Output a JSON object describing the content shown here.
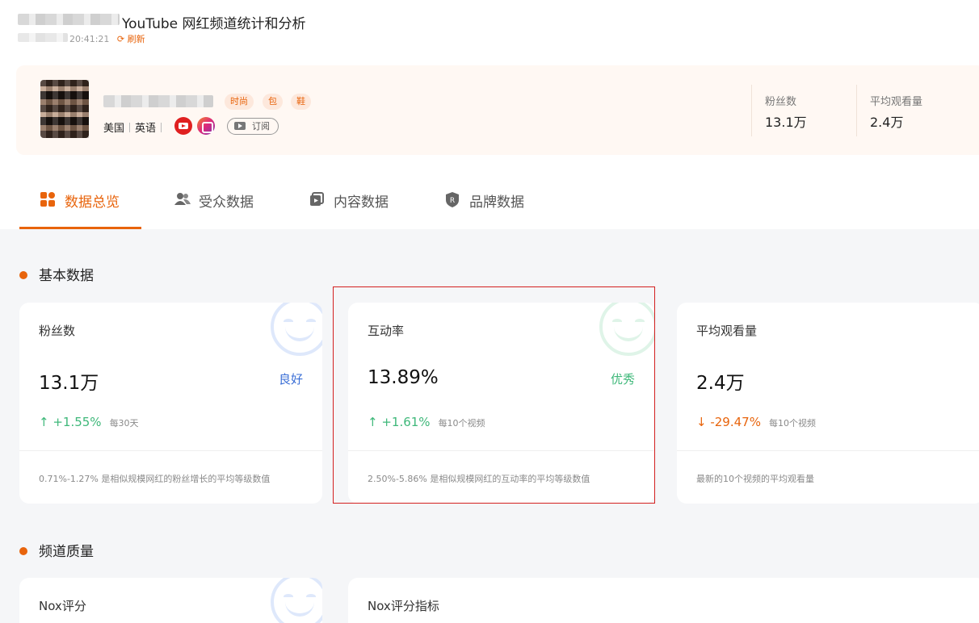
{
  "header": {
    "page_title": "YouTube 网红频道统计和分析",
    "update_time": "20:41:21",
    "refresh_label": "刷新",
    "refresh_icon": "refresh-icon"
  },
  "profile": {
    "tags": [
      "时尚",
      "包",
      "鞋"
    ],
    "country": "美国",
    "language": "英语",
    "subscribe_label": "订阅",
    "stats": [
      {
        "label": "粉丝数",
        "value": "13.1万"
      },
      {
        "label": "平均观看量",
        "value": "2.4万"
      }
    ]
  },
  "tabs": [
    {
      "label": "数据总览",
      "icon": "dashboard-grid-icon",
      "active": true
    },
    {
      "label": "受众数据",
      "icon": "users-icon",
      "active": false
    },
    {
      "label": "内容数据",
      "icon": "video-content-icon",
      "active": false
    },
    {
      "label": "品牌数据",
      "icon": "brand-shield-icon",
      "active": false
    }
  ],
  "basic": {
    "section_title": "基本数据",
    "cards": [
      {
        "label": "粉丝数",
        "value": "13.1万",
        "badge": "良好",
        "badge_color": "#3b6fd6",
        "trend": "↑  +1.55%",
        "trend_color": "#3fb87a",
        "period": "每30天",
        "footer": "0.71%-1.27% 是相似规模网红的粉丝增长的平均等级数值"
      },
      {
        "label": "互动率",
        "value": "13.89%",
        "badge": "优秀",
        "badge_color": "#3fb87a",
        "trend": "↑  +1.61%",
        "trend_color": "#3fb87a",
        "period": "每10个视频",
        "footer": "2.50%-5.86% 是相似规模网红的互动率的平均等级数值"
      },
      {
        "label": "平均观看量",
        "value": "2.4万",
        "badge": "",
        "badge_color": "#3b6fd6",
        "trend": "↓  -29.47%",
        "trend_color": "#e8640c",
        "period": "每10个视频",
        "footer": "最新的10个视频的平均观看量"
      }
    ]
  },
  "quality": {
    "section_title": "频道质量",
    "cards": [
      {
        "label": "Nox评分"
      },
      {
        "label": "Nox评分指标"
      }
    ]
  },
  "colors": {
    "accent": "#e8640c",
    "good": "#3b6fd6",
    "excellent": "#3fb87a"
  }
}
